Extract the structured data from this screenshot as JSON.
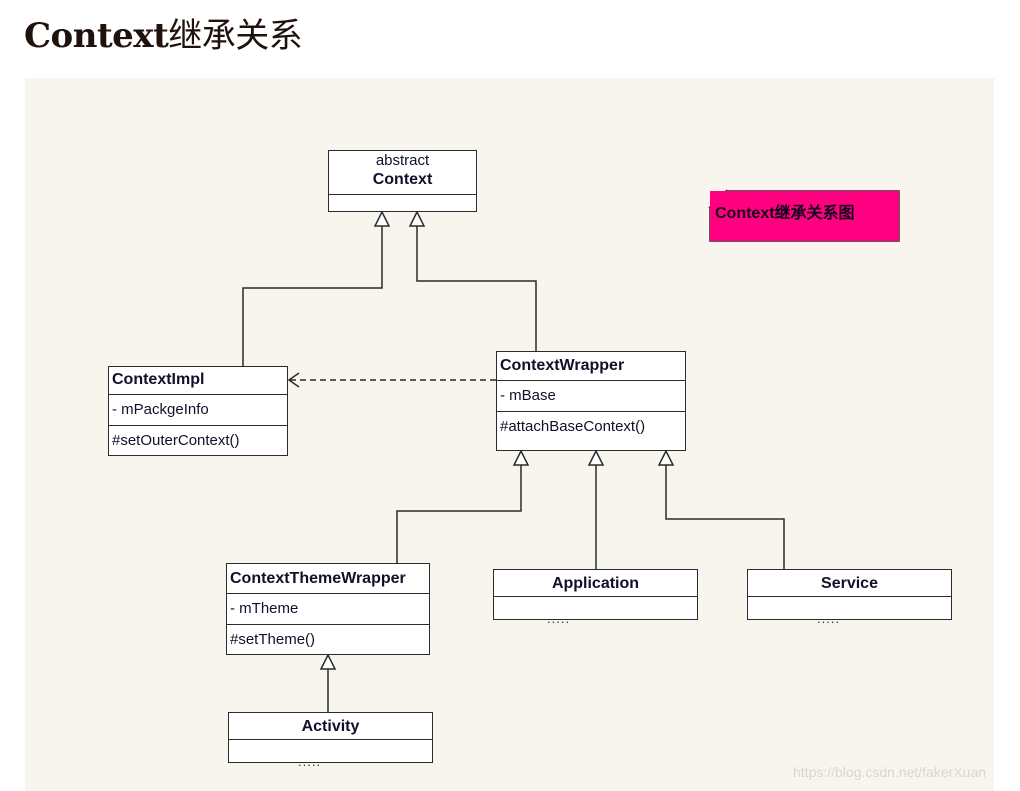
{
  "page": {
    "title_latin": "Context",
    "title_cjk": "继承关系"
  },
  "diagram": {
    "note": "Context继承关系图",
    "classes": {
      "context": {
        "stereotype": "abstract",
        "name": "Context",
        "fields": [],
        "methods": []
      },
      "context_impl": {
        "name": "ContextImpl",
        "fields": [
          "- mPackgeInfo"
        ],
        "methods": [
          "#setOuterContext()"
        ]
      },
      "context_wrapper": {
        "name": "ContextWrapper",
        "fields": [
          "- mBase"
        ],
        "methods": [
          "#attachBaseContext()"
        ]
      },
      "context_theme_wrapper": {
        "name": "ContextThemeWrapper",
        "fields": [
          "- mTheme"
        ],
        "methods": [
          "#setTheme()"
        ]
      },
      "application": {
        "name": "Application",
        "fields": [],
        "ellipsis": "....."
      },
      "service": {
        "name": "Service",
        "fields": [],
        "ellipsis": "....."
      },
      "activity": {
        "name": "Activity",
        "fields": [],
        "ellipsis": "....."
      }
    },
    "relations": [
      {
        "from": "ContextImpl",
        "to": "Context",
        "type": "generalization"
      },
      {
        "from": "ContextWrapper",
        "to": "Context",
        "type": "generalization"
      },
      {
        "from": "ContextWrapper",
        "to": "ContextImpl",
        "type": "dependency"
      },
      {
        "from": "ContextThemeWrapper",
        "to": "ContextWrapper",
        "type": "generalization"
      },
      {
        "from": "Application",
        "to": "ContextWrapper",
        "type": "generalization"
      },
      {
        "from": "Service",
        "to": "ContextWrapper",
        "type": "generalization"
      },
      {
        "from": "Activity",
        "to": "ContextThemeWrapper",
        "type": "generalization"
      }
    ],
    "colors": {
      "background": "#f8f5ef",
      "note_fill": "#ff0080",
      "line": "#2b2b2b"
    }
  },
  "watermark": "https://blog.csdn.net/fakerXuan"
}
